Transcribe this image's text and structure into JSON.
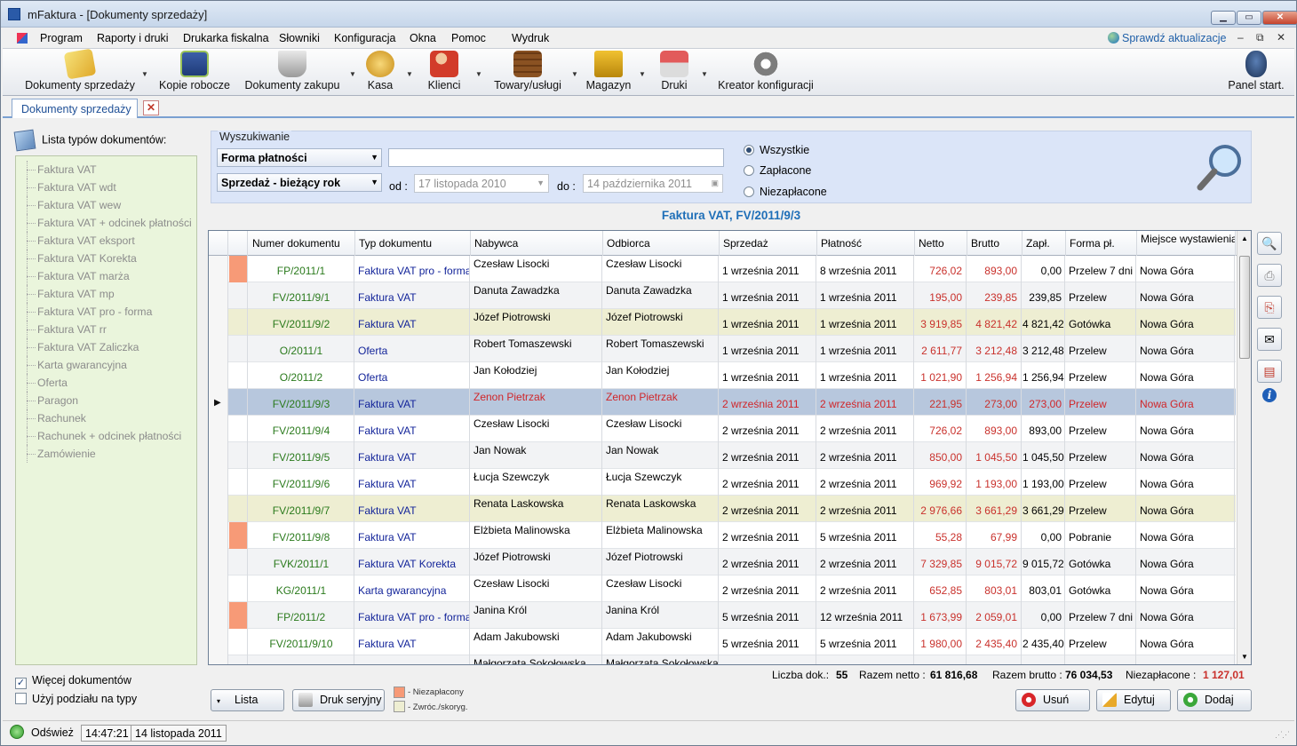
{
  "window": {
    "title": "mFaktura - [Dokumenty sprzedaży]"
  },
  "menu": {
    "items": [
      "Program",
      "Raporty i druki",
      "Drukarka fiskalna",
      "Słowniki",
      "Konfiguracja",
      "Okna",
      "Pomoc",
      "Wydruk"
    ],
    "update_link": "Sprawdź aktualizacje"
  },
  "toolbar": {
    "items": [
      "Dokumenty sprzedaży",
      "Kopie robocze",
      "Dokumenty zakupu",
      "Kasa",
      "Klienci",
      "Towary/usługi",
      "Magazyn",
      "Druki",
      "Kreator konfiguracji",
      "Panel start."
    ],
    "icons": [
      "documents-stack-icon",
      "floppy-disk-icon",
      "shopping-cart-icon",
      "coins-icon",
      "clients-icon",
      "crate-icon",
      "forklift-icon",
      "printer-icon",
      "gears-icon",
      "mouse-icon"
    ]
  },
  "tab": {
    "label": "Dokumenty sprzedaży",
    "close_glyph": "✕"
  },
  "left_panel": {
    "header": "Lista typów dokumentów:",
    "items": [
      "Faktura VAT",
      "Faktura VAT  wdt",
      "Faktura VAT  wew",
      "Faktura VAT + odcinek płatności",
      "Faktura VAT eksport",
      "Faktura VAT Korekta",
      "Faktura VAT marża",
      "Faktura VAT mp",
      "Faktura VAT pro - forma",
      "Faktura VAT rr",
      "Faktura VAT Zaliczka",
      "Karta gwarancyjna",
      "Oferta",
      "Paragon",
      "Rachunek",
      "Rachunek + odcinek płatności",
      "Zamówienie"
    ],
    "more_docs": {
      "label": "Więcej dokumentów",
      "checked": true
    },
    "split_by_type": {
      "label": "Użyj podziału na typy",
      "checked": false
    }
  },
  "search": {
    "legend": "Wyszukiwanie",
    "payment_form": "Forma płatności",
    "period": "Sprzedaż - bieżący rok",
    "text_value": "",
    "from_label": "od :",
    "from_date": "17    listopada    2010",
    "to_label": "do :",
    "to_date": "14 października 2011",
    "radios": [
      {
        "label": "Wszystkie",
        "selected": true
      },
      {
        "label": "Zapłacone",
        "selected": false
      },
      {
        "label": "Niezapłacone",
        "selected": false
      }
    ]
  },
  "document_title": "Faktura VAT, FV/2011/9/3",
  "grid": {
    "columns": [
      "Numer dokumentu",
      "Typ dokumentu",
      "Nabywca",
      "Odbiorca",
      "Sprzedaż",
      "Płatność",
      "Netto",
      "Brutto",
      "Zapł.",
      "Forma pł.",
      "Miejsce wystawienia"
    ],
    "rows": [
      {
        "mark": "orange",
        "style": "",
        "num": "FP/2011/1",
        "typ": "Faktura VAT pro - forma",
        "nab": "Czesław Lisocki",
        "odb": "Czesław Lisocki",
        "spr": "1 września 2011",
        "pla": "8 września 2011",
        "net": "726,02",
        "bru": "893,00",
        "zap": "0,00",
        "for": "Przelew 7 dni",
        "mie": "Nowa Góra"
      },
      {
        "mark": "",
        "style": "alt",
        "num": "FV/2011/9/1",
        "typ": "Faktura VAT",
        "nab": "Danuta Zawadzka",
        "odb": "Danuta Zawadzka",
        "spr": "1 września 2011",
        "pla": "1 września 2011",
        "net": "195,00",
        "bru": "239,85",
        "zap": "239,85",
        "for": "Przelew",
        "mie": "Nowa Góra"
      },
      {
        "mark": "",
        "style": "yellow",
        "num": "FV/2011/9/2",
        "typ": "Faktura VAT",
        "nab": "Józef Piotrowski",
        "odb": "Józef Piotrowski",
        "spr": "1 września 2011",
        "pla": "1 września 2011",
        "net": "3 919,85",
        "bru": "4 821,42",
        "zap": "4 821,42",
        "for": "Gotówka",
        "mie": "Nowa Góra"
      },
      {
        "mark": "",
        "style": "alt",
        "num": "O/2011/1",
        "typ": "Oferta",
        "nab": "Robert Tomaszewski",
        "odb": "Robert Tomaszewski",
        "spr": "1 września 2011",
        "pla": "1 września 2011",
        "net": "2 611,77",
        "bru": "3 212,48",
        "zap": "3 212,48",
        "for": "Przelew",
        "mie": "Nowa Góra"
      },
      {
        "mark": "",
        "style": "",
        "num": "O/2011/2",
        "typ": "Oferta",
        "nab": "Jan Kołodziej",
        "odb": "Jan Kołodziej",
        "spr": "1 września 2011",
        "pla": "1 września 2011",
        "net": "1 021,90",
        "bru": "1 256,94",
        "zap": "1 256,94",
        "for": "Przelew",
        "mie": "Nowa Góra"
      },
      {
        "mark": "",
        "style": "sel",
        "num": "FV/2011/9/3",
        "typ": "Faktura VAT",
        "nab": "Zenon Pietrzak",
        "odb": "Zenon Pietrzak",
        "spr": "2 września 2011",
        "pla": "2 września 2011",
        "net": "221,95",
        "bru": "273,00",
        "zap": "273,00",
        "for": "Przelew",
        "mie": "Nowa Góra"
      },
      {
        "mark": "",
        "style": "",
        "num": "FV/2011/9/4",
        "typ": "Faktura VAT",
        "nab": "Czesław Lisocki",
        "odb": "Czesław Lisocki",
        "spr": "2 września 2011",
        "pla": "2 września 2011",
        "net": "726,02",
        "bru": "893,00",
        "zap": "893,00",
        "for": "Przelew",
        "mie": "Nowa Góra"
      },
      {
        "mark": "",
        "style": "alt",
        "num": "FV/2011/9/5",
        "typ": "Faktura VAT",
        "nab": "Jan Nowak",
        "odb": "Jan Nowak",
        "spr": "2 września 2011",
        "pla": "2 września 2011",
        "net": "850,00",
        "bru": "1 045,50",
        "zap": "1 045,50",
        "for": "Przelew",
        "mie": "Nowa Góra"
      },
      {
        "mark": "",
        "style": "",
        "num": "FV/2011/9/6",
        "typ": "Faktura VAT",
        "nab": "Łucja Szewczyk",
        "odb": "Łucja Szewczyk",
        "spr": "2 września 2011",
        "pla": "2 września 2011",
        "net": "969,92",
        "bru": "1 193,00",
        "zap": "1 193,00",
        "for": "Przelew",
        "mie": "Nowa Góra"
      },
      {
        "mark": "",
        "style": "yellow",
        "num": "FV/2011/9/7",
        "typ": "Faktura VAT",
        "nab": "Renata Laskowska",
        "odb": "Renata Laskowska",
        "spr": "2 września 2011",
        "pla": "2 września 2011",
        "net": "2 976,66",
        "bru": "3 661,29",
        "zap": "3 661,29",
        "for": "Przelew",
        "mie": "Nowa Góra"
      },
      {
        "mark": "orange",
        "style": "",
        "num": "FV/2011/9/8",
        "typ": "Faktura VAT",
        "nab": "Elżbieta Malinowska",
        "odb": "Elżbieta Malinowska",
        "spr": "2 września 2011",
        "pla": "5 września 2011",
        "net": "55,28",
        "bru": "67,99",
        "zap": "0,00",
        "for": "Pobranie",
        "mie": "Nowa Góra"
      },
      {
        "mark": "",
        "style": "alt",
        "num": "FVK/2011/1",
        "typ": "Faktura VAT Korekta",
        "nab": "Józef Piotrowski",
        "odb": "Józef Piotrowski",
        "spr": "2 września 2011",
        "pla": "2 września 2011",
        "net": "7 329,85",
        "bru": "9 015,72",
        "zap": "9 015,72",
        "for": "Gotówka",
        "mie": "Nowa Góra"
      },
      {
        "mark": "",
        "style": "",
        "num": "KG/2011/1",
        "typ": "Karta gwarancyjna",
        "nab": "Czesław Lisocki",
        "odb": "Czesław Lisocki",
        "spr": "2 września 2011",
        "pla": "2 września 2011",
        "net": "652,85",
        "bru": "803,01",
        "zap": "803,01",
        "for": "Gotówka",
        "mie": "Nowa Góra"
      },
      {
        "mark": "orange",
        "style": "alt",
        "num": "FP/2011/2",
        "typ": "Faktura VAT pro - forma",
        "nab": "Janina Król",
        "odb": "Janina Król",
        "spr": "5 września 2011",
        "pla": "12 września 2011",
        "net": "1 673,99",
        "bru": "2 059,01",
        "zap": "0,00",
        "for": "Przelew 7 dni",
        "mie": "Nowa Góra"
      },
      {
        "mark": "",
        "style": "",
        "num": "FV/2011/9/10",
        "typ": "Faktura VAT",
        "nab": "Adam Jakubowski",
        "odb": "Adam Jakubowski",
        "spr": "5 września 2011",
        "pla": "5 września 2011",
        "net": "1 980,00",
        "bru": "2 435,40",
        "zap": "2 435,40",
        "for": "Przelew",
        "mie": "Nowa Góra"
      },
      {
        "mark": "",
        "style": "alt",
        "num": "",
        "typ": "",
        "nab": "Małgorzata Sokołowska",
        "odb": "Małgorzata Sokołowska",
        "spr": "",
        "pla": "",
        "net": "",
        "bru": "",
        "zap": "",
        "for": "",
        "mie": ""
      }
    ]
  },
  "summary": {
    "count_label": "Liczba dok.:",
    "count": "55",
    "net_label": "Razem netto :",
    "net": "61 816,68",
    "gross_label": "Razem brutto :",
    "gross": "76 034,53",
    "unpaid_label": "Niezapłacone :",
    "unpaid": "1 127,01"
  },
  "bottom": {
    "list_btn": "Lista",
    "serial_print_btn": "Druk seryjny",
    "legend_unpaid": "- Niezapłacony",
    "legend_returned": "- Zwróc./skoryg.",
    "delete_btn": "Usuń",
    "edit_btn": "Edytuj",
    "add_btn": "Dodaj"
  },
  "status": {
    "refresh": "Odśwież",
    "time": "14:47:21",
    "date": "14 listopada 2011"
  },
  "colors": {
    "unpaid": "#f79a77",
    "returned": "#eeeed2",
    "selected_row": "#b7c7dd",
    "accent": "#1f6fb8"
  }
}
